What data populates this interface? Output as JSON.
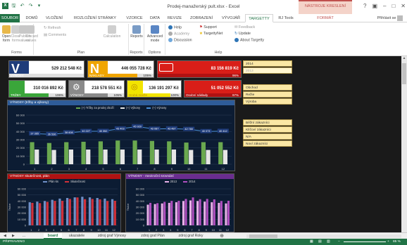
{
  "window": {
    "title": "Prodej-manažerský pult.xlsx - Excel",
    "context_header": "NÁSTROJE KRESLENÍ",
    "help": "?",
    "user": "Přihlásit se"
  },
  "tabs": [
    "SOUBOR",
    "DOMŮ",
    "VLOŽENÍ",
    "ROZLOŽENÍ STRÁNKY",
    "VZORCE",
    "DATA",
    "REVIZE",
    "ZOBRAZENÍ",
    "VÝVOJÁŘ",
    "TARGETTY",
    "RJ Tools",
    "FORMÁT"
  ],
  "ribbon": {
    "forms": {
      "open": "Open form",
      "close": "Close form",
      "publish": "Publish values",
      "discard": "Discard values",
      "label": "Forms"
    },
    "plan": {
      "refresh": "Refresh",
      "comments": "Comments",
      "calculation": "Calculation",
      "label": "Plan"
    },
    "reports": {
      "label": "Reports",
      "btn": "Reports"
    },
    "options": {
      "advanced": "Advanced mode",
      "label": "Options"
    },
    "help": {
      "help": "Help",
      "academy": "Academy",
      "discussion": "Discussion",
      "support": "Support",
      "targettynet": "TargettyNet",
      "feedback": "Feedback",
      "update": "Update",
      "about": "About Targetty",
      "label": "Help"
    }
  },
  "kpis": [
    {
      "glyph": "V",
      "label": "VÝNOSY",
      "value": "529 212 548 Kč",
      "pct": ""
    },
    {
      "glyph": "N",
      "label": "NÁKLADY",
      "value": "446 055 728 Kč",
      "pct": "105%"
    },
    {
      "glyph": "",
      "label": "",
      "value": "83 156 819 Kč",
      "pct": "96%"
    },
    {
      "glyph": "",
      "label": "TRŽBY",
      "value": "310 016 892 Kč",
      "pct": "106%"
    },
    {
      "glyph": "",
      "label": "VÝNOSY",
      "value": "218 578 551 Kč",
      "pct": "105%"
    },
    {
      "glyph": "",
      "label": "Hrubá marže",
      "value": "136 191 297 Kč",
      "pct": "100%"
    },
    {
      "glyph": "",
      "label": "Osobní náklady",
      "value": "51 052 552 Kč",
      "pct": "97%"
    }
  ],
  "slicers": {
    "years": [
      "2014",
      "2013"
    ],
    "sections": [
      "Obchod",
      "Režie",
      "Výroba"
    ],
    "customers": [
      "Běžní zákazníci",
      "Klíčoví zákazníci",
      "N/A",
      "Noví zákazníci"
    ]
  },
  "colors": {
    "excel_green": "#217346",
    "kpi_blue": "#1f3c7a",
    "kpi_orange": "#f0a500",
    "kpi_red": "#d91e18",
    "kpi_green": "#3aa63a",
    "kpi_gray": "#8a8a8a",
    "kpi_yellow": "#f2e400",
    "panel_bg": "#0c1c33"
  },
  "chart_main": {
    "title": "VÝNOSY (tržby a výkony)",
    "legend": [
      "(+) Tržby za prodej zboží",
      "(+) Výkony",
      "(+) Výnosy"
    ],
    "chart_data": {
      "type": "bar",
      "categories": [
        "1",
        "2",
        "3",
        "4",
        "5",
        "6",
        "7",
        "8",
        "9",
        "10",
        "11",
        "12"
      ],
      "series": [
        {
          "name": "(+) Tržby za prodej zboží",
          "values": [
            27000,
            26000,
            27000,
            27500,
            28000,
            29000,
            29000,
            28500,
            28000,
            26500,
            27000,
            27000
          ]
        },
        {
          "name": "(+) Výkony",
          "values": [
            18000,
            17500,
            18000,
            18000,
            18000,
            18000,
            18000,
            18000,
            18000,
            17500,
            17500,
            17500
          ]
        },
        {
          "name": "(+) Výnosy",
          "values": [
            37365,
            36536,
            38608,
            40227,
            40352,
            43403,
            45920,
            43087,
            43487,
            42780,
            40073,
            40412
          ]
        }
      ],
      "data_labels": [
        "37 365",
        "36 536",
        "38 608",
        "40 227",
        "40 352",
        "43 403",
        "45 920",
        "43 087",
        "43 487",
        "42 780",
        "40 073",
        "40 412"
      ],
      "yticks": [
        "0",
        "10 000",
        "20 000",
        "30 000",
        "40 000",
        "50 000",
        "60 000"
      ],
      "ylim": [
        0,
        60000
      ]
    }
  },
  "chart_left": {
    "title": "VÝNOSY skutečnost, plán",
    "legend": [
      "Plán ks",
      "Skutečnost"
    ],
    "ylabel": "Tisíce",
    "chart_data": {
      "type": "bar",
      "categories": [
        "1",
        "2",
        "3",
        "4",
        "5",
        "6",
        "7",
        "8",
        "9",
        "10",
        "11",
        "12"
      ],
      "series": [
        {
          "name": "Plán ks",
          "values": [
            38000,
            39000,
            40000,
            42000,
            44000,
            45000,
            46000,
            47000,
            46000,
            45000,
            44000,
            43000
          ]
        },
        {
          "name": "Skutečnost",
          "values": [
            37000,
            36500,
            38600,
            40200,
            40300,
            43400,
            45900,
            43000,
            43400,
            42700,
            40000,
            40400
          ]
        }
      ],
      "yticks": [
        "0",
        "10 000",
        "20 000",
        "30 000",
        "40 000",
        "50 000",
        "60 000"
      ],
      "ylim": [
        0,
        60000
      ]
    }
  },
  "chart_right": {
    "title": "VÝNOSY - meziroční srovnání",
    "legend": [
      "2013",
      "2014"
    ],
    "ylabel": "Tisíce",
    "chart_data": {
      "type": "bar",
      "categories": [
        "1",
        "2",
        "3",
        "4",
        "5",
        "6",
        "7",
        "8",
        "9",
        "10",
        "11",
        "12"
      ],
      "series": [
        {
          "name": "2013",
          "values": [
            34000,
            35000,
            36000,
            37000,
            38000,
            40000,
            41000,
            40000,
            39000,
            38000,
            37000,
            36000
          ]
        },
        {
          "name": "2014",
          "values": [
            37000,
            36500,
            38600,
            40200,
            40300,
            43400,
            45900,
            43000,
            43400,
            42700,
            40000,
            40400
          ]
        }
      ],
      "yticks": [
        "0",
        "10 000",
        "20 000",
        "30 000",
        "40 000",
        "50 000",
        "60 000"
      ],
      "ylim": [
        0,
        60000
      ]
    }
  },
  "sheet_tabs": [
    "board",
    "ukazatele",
    "zdroj graf Výnosy",
    "zdroj graf Plán",
    "zdroj graf Roky"
  ],
  "status": {
    "left": "PŘIPRAVENO",
    "zoom": "85 %"
  }
}
